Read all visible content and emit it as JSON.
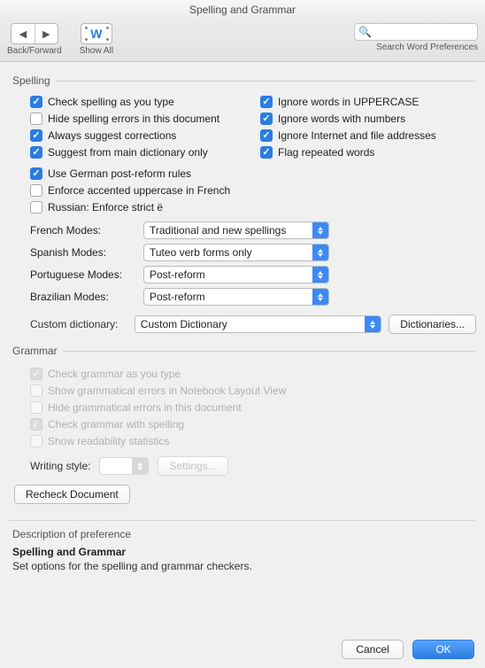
{
  "title": "Spelling and Grammar",
  "toolbar": {
    "back_forward_label": "Back/Forward",
    "show_all_label": "Show All",
    "search_placeholder": "",
    "search_caption": "Search Word Preferences"
  },
  "spelling": {
    "group_label": "Spelling",
    "left": [
      {
        "label": "Check spelling as you type",
        "checked": true
      },
      {
        "label": "Hide spelling errors in this document",
        "checked": false
      },
      {
        "label": "Always suggest corrections",
        "checked": true
      },
      {
        "label": "Suggest from main dictionary only",
        "checked": true
      }
    ],
    "right": [
      {
        "label": "Ignore words in UPPERCASE",
        "checked": true
      },
      {
        "label": "Ignore words with numbers",
        "checked": true
      },
      {
        "label": "Ignore Internet and file addresses",
        "checked": true
      },
      {
        "label": "Flag repeated words",
        "checked": true
      }
    ],
    "extra": [
      {
        "label": "Use German post-reform rules",
        "checked": true
      },
      {
        "label": "Enforce accented uppercase in French",
        "checked": false
      },
      {
        "label": "Russian: Enforce strict ё",
        "checked": false
      }
    ],
    "modes": {
      "french": {
        "label": "French Modes:",
        "value": "Traditional and new spellings"
      },
      "spanish": {
        "label": "Spanish Modes:",
        "value": "Tuteo verb forms only"
      },
      "portuguese": {
        "label": "Portuguese Modes:",
        "value": "Post-reform"
      },
      "brazilian": {
        "label": "Brazilian Modes:",
        "value": "Post-reform"
      }
    },
    "custom_dict": {
      "label": "Custom dictionary:",
      "value": "Custom Dictionary",
      "button": "Dictionaries..."
    }
  },
  "grammar": {
    "group_label": "Grammar",
    "items": [
      {
        "label": "Check grammar as you type",
        "checked": true
      },
      {
        "label": "Show grammatical errors in Notebook Layout View",
        "checked": false
      },
      {
        "label": "Hide grammatical errors in this document",
        "checked": false
      },
      {
        "label": "Check grammar with spelling",
        "checked": true
      },
      {
        "label": "Show readability statistics",
        "checked": false
      }
    ],
    "writing_style_label": "Writing style:",
    "writing_style_value": "",
    "settings_btn": "Settings...",
    "recheck_btn": "Recheck Document"
  },
  "description": {
    "heading": "Description of preference",
    "title": "Spelling and Grammar",
    "text": "Set options for the spelling and grammar checkers."
  },
  "footer": {
    "cancel": "Cancel",
    "ok": "OK"
  }
}
